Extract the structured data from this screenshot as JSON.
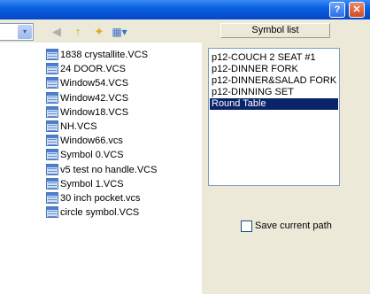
{
  "toolbar": {
    "path_combo_arrow": "▾",
    "back_icon": "◀",
    "up_folder_icon": "↑",
    "new_folder_icon": "✦",
    "view_menu_icon": "▦▾"
  },
  "title_buttons": {
    "help": "?",
    "close": "✕"
  },
  "symbol_list_header": "Symbol list",
  "files": [
    "1838 crystallite.VCS",
    "24 DOOR.VCS",
    "Window54.VCS",
    "Window42.VCS",
    "Window18.VCS",
    "NH.VCS",
    "Window66.vcs",
    "Symbol 0.VCS",
    "v5 test no handle.VCS",
    "Symbol 1.VCS",
    "30 inch pocket.vcs",
    "circle symbol.VCS"
  ],
  "symbols": [
    "p12-COUCH 2 SEAT #1",
    "p12-DINNER FORK",
    "p12-DINNER&SALAD FORK",
    "p12-DINNING SET",
    "Round Table"
  ],
  "selected_symbol": "Round Table",
  "save_path": {
    "label": "Save current path",
    "checked": false
  },
  "colors": {
    "titlebar": "#0a5fe0",
    "selection": "#0a246a",
    "dialog_bg": "#ece9d8"
  }
}
